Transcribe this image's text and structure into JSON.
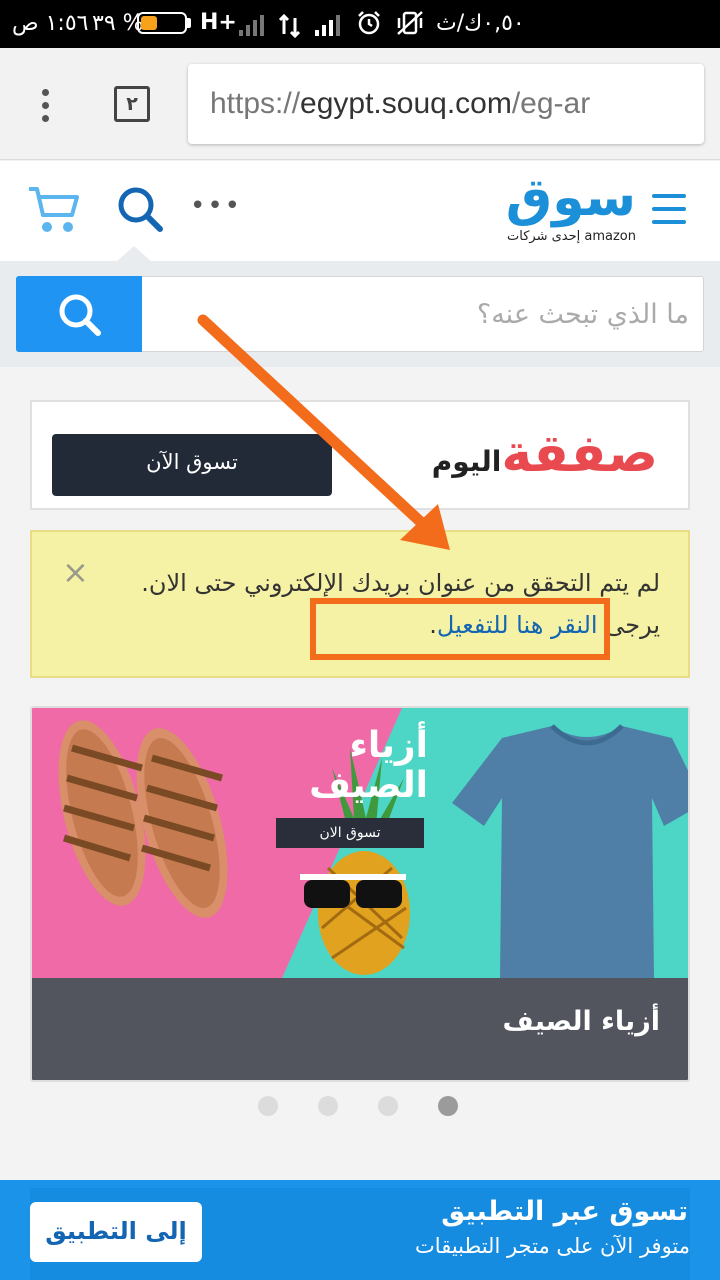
{
  "status_bar": {
    "time": "١:٥٦ ص",
    "battery": "٣٩ %",
    "battery_level": 0.39,
    "network": "H+",
    "data_speed": "٠,٥٠ك/ث",
    "icons": [
      "signal-icon",
      "data-transfer-icon",
      "alarm-icon",
      "vibrate-off-icon"
    ]
  },
  "browser": {
    "tab_count": "٢",
    "url_scheme": "https://",
    "url_host": "egypt.souq.com",
    "url_path": "/eg-ar"
  },
  "header": {
    "logo_text": "سوق",
    "logo_subtitle": "إحدى شركات amazon",
    "more_icon": "more-dots-icon",
    "cart_icon": "cart-icon",
    "search_icon": "search-icon",
    "menu_icon": "hamburger-icon",
    "brand_color": "#1b8fd7"
  },
  "search": {
    "placeholder": "ما الذي تبحث عنه؟",
    "button_color": "#1f94f3"
  },
  "deal": {
    "logo_big": "صفقة",
    "logo_small": "اليوم",
    "button_label": "تسوق الآن"
  },
  "alert": {
    "text_before": "لم يتم التحقق من عنوان بريدك الإلكتروني حتى الان. يرجى ",
    "link_text": "النقر هنا للتفعيل",
    "text_after": ".",
    "close_icon": "×",
    "highlight_color": "#f36c1c"
  },
  "carousel": {
    "banner_title": "أزياء الصيف",
    "banner_button": "تسوق الان",
    "caption": "أزياء الصيف",
    "slides_total": 4,
    "active_index": 3
  },
  "app_banner": {
    "title": "تسوق عبر التطبيق",
    "subtitle": "متوفر الآن على متجر التطبيقات",
    "button_label": "إلى التطبيق"
  }
}
